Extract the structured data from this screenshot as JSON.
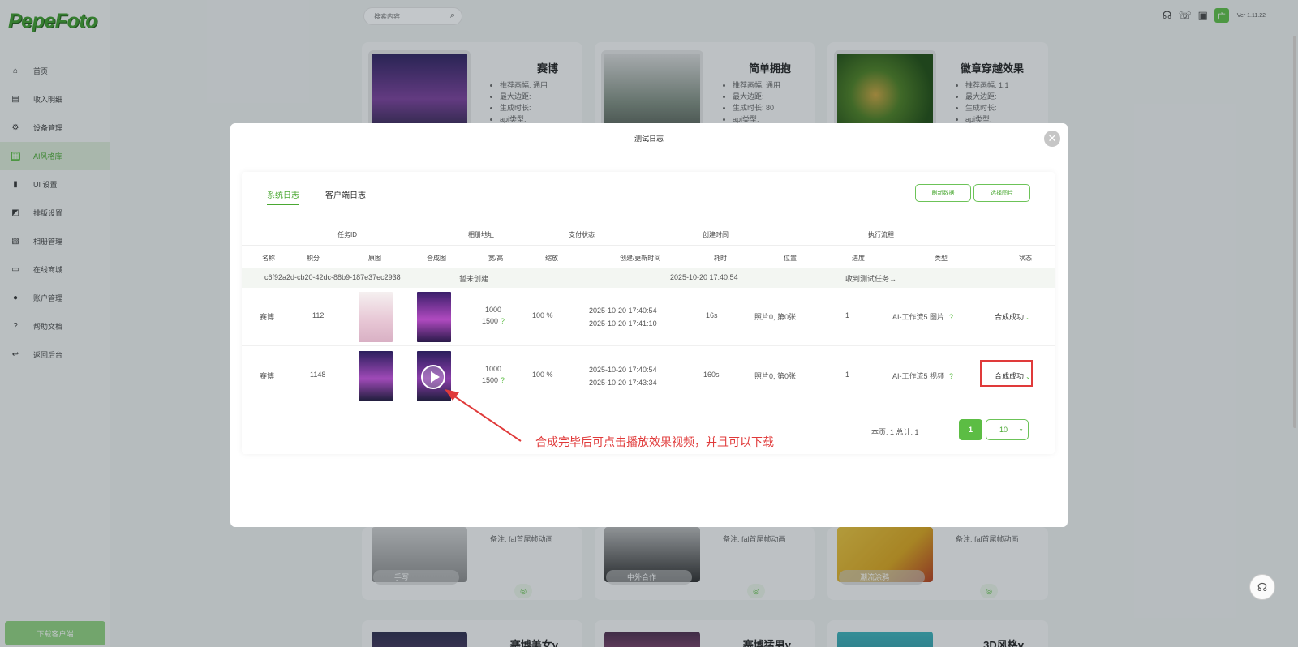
{
  "app": {
    "logo": "PepeFoto",
    "version": "Ver 1.11.22",
    "search_placeholder": "搜索内容",
    "download_label": "下载客户端",
    "avatar_char": "广"
  },
  "sidebar": {
    "items": [
      {
        "label": "首页",
        "icon": "home-icon",
        "glyph": "⌂"
      },
      {
        "label": "收入明细",
        "icon": "wallet-icon",
        "glyph": "▤"
      },
      {
        "label": "设备管理",
        "icon": "gear-icon",
        "glyph": "⚙"
      },
      {
        "label": "AI风格库",
        "icon": "grid-icon",
        "glyph": "▦"
      },
      {
        "label": "UI 设置",
        "icon": "bookmark-icon",
        "glyph": "▮"
      },
      {
        "label": "排版设置",
        "icon": "layout-icon",
        "glyph": "◩"
      },
      {
        "label": "相册管理",
        "icon": "image-icon",
        "glyph": "▧"
      },
      {
        "label": "在线商城",
        "icon": "store-icon",
        "glyph": "▭"
      },
      {
        "label": "账户管理",
        "icon": "user-icon",
        "glyph": "●"
      },
      {
        "label": "帮助文档",
        "icon": "help-icon",
        "glyph": "?"
      },
      {
        "label": "返回后台",
        "icon": "exit-icon",
        "glyph": "↩"
      }
    ]
  },
  "cards": [
    {
      "title": "赛博",
      "rows": [
        "推荐画幅:  通用",
        "最大边距:",
        "生成时长:",
        "api类型:"
      ]
    },
    {
      "title": "简单拥抱",
      "rows": [
        "推荐画幅:  通用",
        "最大边距:",
        "生成时长:  80",
        "api类型:"
      ]
    },
    {
      "title": "徽章穿越效果",
      "rows": [
        "推荐画幅:  1:1",
        "最大边距:",
        "生成时长:",
        "api类型:"
      ]
    }
  ],
  "bottom_cards": [
    {
      "note": "备注:  fal首尾帧动画",
      "label": "手写"
    },
    {
      "note": "备注:  fal首尾帧动画",
      "label": "中外合作"
    },
    {
      "note": "备注:  fal首尾帧动画",
      "label": "潮流涂鸦"
    }
  ],
  "row3_cards": [
    {
      "title": "赛博美女v"
    },
    {
      "title": "赛博猛男v"
    },
    {
      "title": "3D风格v"
    }
  ],
  "modal": {
    "title": "测试日志",
    "tabs": [
      "系统日志",
      "客户端日志"
    ],
    "refresh_label": "刷新数据",
    "select_image_label": "选择图片",
    "group_headers": [
      "任务ID",
      "相册地址",
      "支付状态",
      "创建时间",
      "执行流程"
    ],
    "columns": [
      "名称",
      "积分",
      "原图",
      "合成图",
      "宽/高",
      "缩放",
      "创建/更新时间",
      "耗时",
      "位置",
      "进度",
      "类型",
      "状态"
    ],
    "summary": {
      "task_id": "c6f92a2d-cb20-42dc-88b9-187e37ec2938",
      "album": "暂未创建",
      "created": "2025-10-20 17:40:54",
      "flow": "收到测试任务→"
    },
    "rows": [
      {
        "name": "赛博",
        "points": "112",
        "width": "1000",
        "height": "1500",
        "scale": "100 %",
        "created": "2025-10-20 17:40:54",
        "updated": "2025-10-20 17:41:10",
        "duration": "16s",
        "position": "照片0,  第0张",
        "progress": "1",
        "type": "AI-工作流5 图片",
        "status": "合成成功"
      },
      {
        "name": "赛博",
        "points": "1148",
        "width": "1000",
        "height": "1500",
        "scale": "100 %",
        "created": "2025-10-20 17:40:54",
        "updated": "2025-10-20 17:43:34",
        "duration": "160s",
        "position": "照片0,  第0张",
        "progress": "1",
        "type": "AI-工作流5 视频",
        "status": "合成成功"
      }
    ],
    "pager": {
      "summary": "本页:  1   总计:  1",
      "current_page": "1",
      "page_size": "10"
    },
    "annotation": "合成完毕后可点击播放效果视频，并且可以下载"
  },
  "colors": {
    "accent": "#5cbd44",
    "annotation_red": "#e03a3a"
  }
}
